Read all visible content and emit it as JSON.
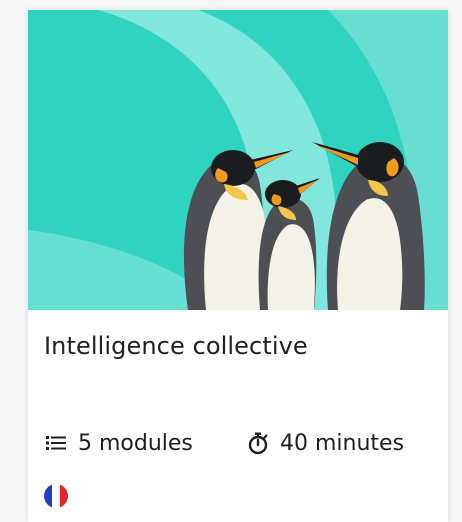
{
  "course": {
    "title": "Intelligence collective",
    "modules_label": "5 modules",
    "duration_label": "40 minutes",
    "language_flag": "fr-flag-icon"
  },
  "icons": {
    "modules": "list-icon",
    "duration": "stopwatch-icon"
  },
  "colors": {
    "hero_background": "#2fd3bf",
    "hero_arc": "#8fe9df",
    "text": "#1f1f1f",
    "flag_blue": "#1f3fbf",
    "flag_white": "#ffffff",
    "flag_red": "#e32630"
  }
}
